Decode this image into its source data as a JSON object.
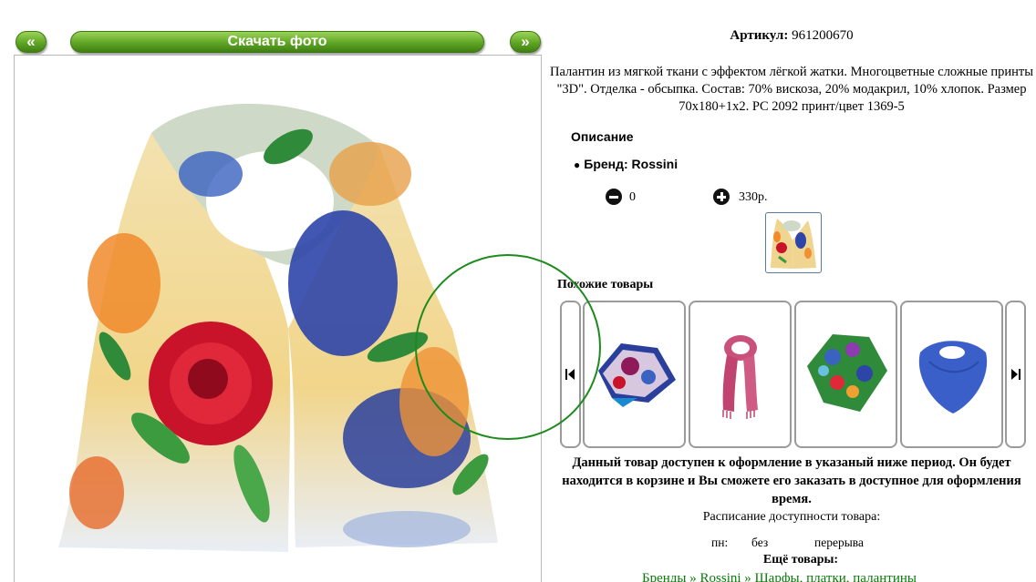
{
  "toolbar": {
    "prev_label": "«",
    "download_label": "Скачать фото",
    "next_label": "»"
  },
  "product": {
    "article_label": "Артикул:",
    "article_value": "961200670",
    "description": "Палантин из мягкой ткани с эффектом лёгкой жатки. Многоцветные сложные принты \"3D\". Отделка - обсыпка. Состав: 70% вискоза, 20% модакрил, 10% хлопок. Размер 70х180+1х2. PC 2092 принт/цвет 1369-5",
    "description_heading": "Описание",
    "brand_label": "Бренд: Rossini",
    "quantity": "0",
    "price": "330р."
  },
  "similar": {
    "heading": "Похожие товары",
    "items": [
      {
        "name": "multicolor-square-scarf"
      },
      {
        "name": "pink-scarf"
      },
      {
        "name": "floral-square-scarf"
      },
      {
        "name": "blue-square-scarf"
      }
    ]
  },
  "availability": {
    "notice": "Данный товар доступен к оформление в указаный ниже период. Он будет находится в корзине и Вы сможете его заказать в доступное для оформления время.",
    "schedule_title": "Расписание доступности товара:",
    "schedule": {
      "day": "пн:",
      "from": "без",
      "to": "перерыва"
    }
  },
  "more": {
    "heading": "Ещё товары:",
    "breadcrumb": [
      "Бренды",
      "Rossini",
      "Шарфы, платки, палантины"
    ],
    "separator": "»"
  },
  "colors": {
    "button_green": "#5fa624",
    "link_green": "#0a7a0a",
    "focus_circle": "#1c8a1c"
  }
}
